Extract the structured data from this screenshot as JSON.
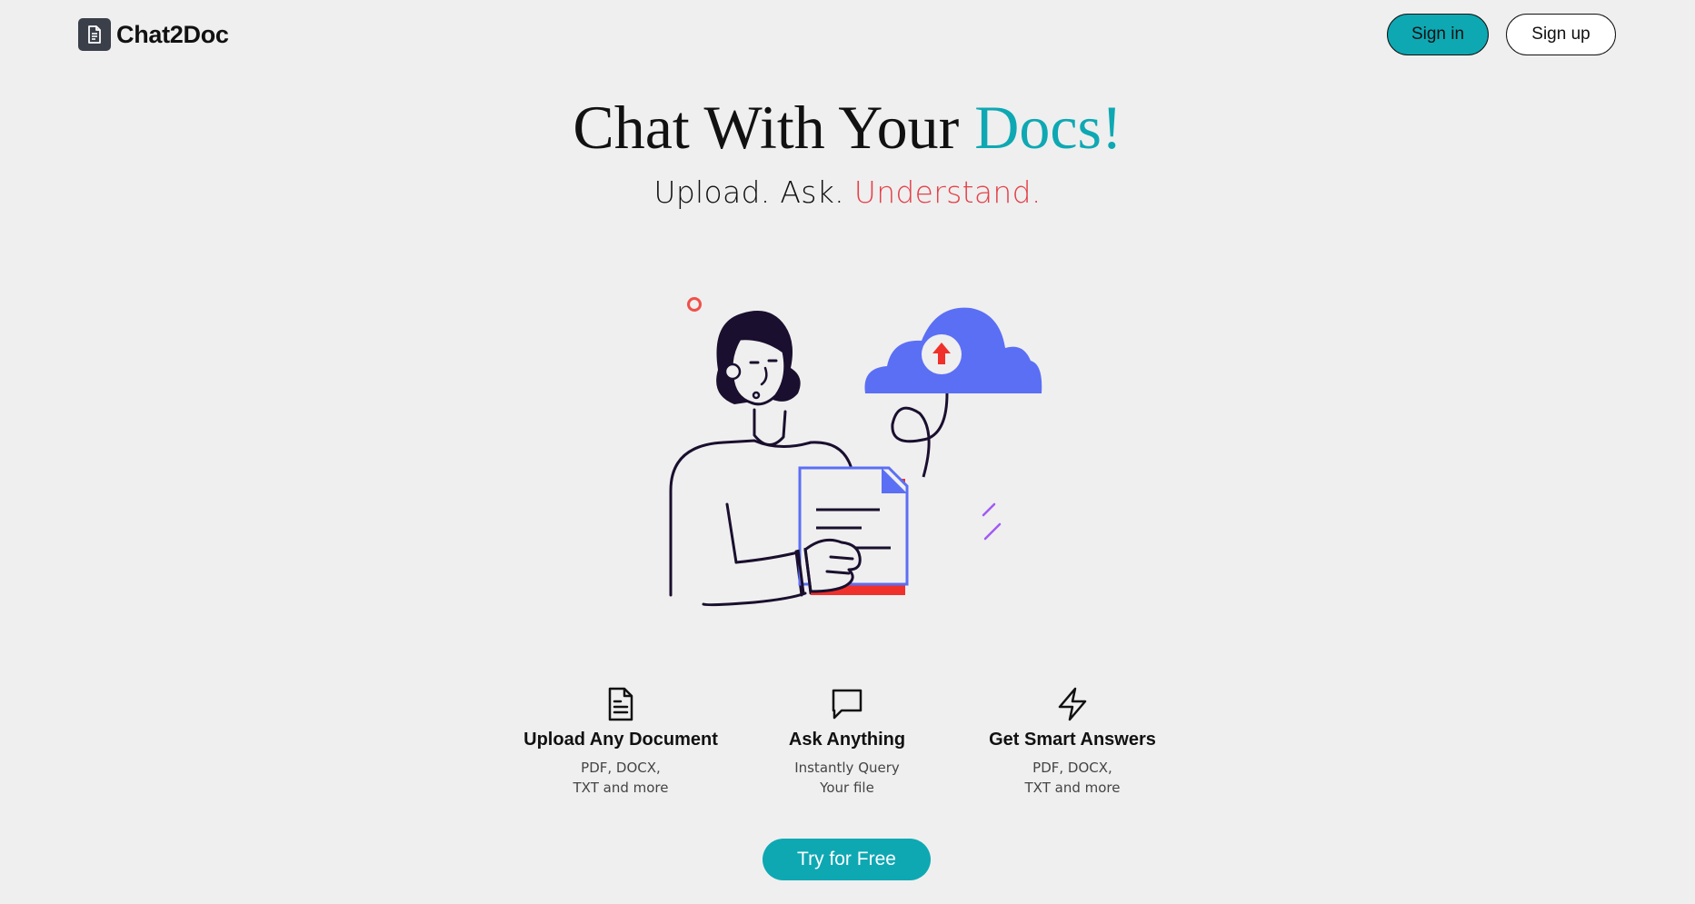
{
  "header": {
    "logo_text": "Chat2Doc",
    "signin_label": "Sign in",
    "signup_label": "Sign up"
  },
  "hero": {
    "title_part1": "Chat With Your ",
    "title_accent": "Docs!",
    "subtitle_part1": "Upload. Ask. ",
    "subtitle_accent": "Understand."
  },
  "features": [
    {
      "icon": "document-icon",
      "title": "Upload Any Document",
      "desc_line1": "PDF, DOCX,",
      "desc_line2": "TXT and more"
    },
    {
      "icon": "chat-bubble-icon",
      "title": "Ask Anything",
      "desc_line1": "Instantly Query",
      "desc_line2": "Your file"
    },
    {
      "icon": "lightning-icon",
      "title": "Get Smart Answers",
      "desc_line1": "PDF, DOCX,",
      "desc_line2": "TXT and more"
    }
  ],
  "cta": {
    "label": "Try for Free"
  },
  "colors": {
    "background": "#efefef",
    "accent_teal": "#0ea8b3",
    "accent_red": "#e4414a",
    "cloud_blue": "#5b6ff5",
    "dark_ink": "#1a0f2e"
  }
}
